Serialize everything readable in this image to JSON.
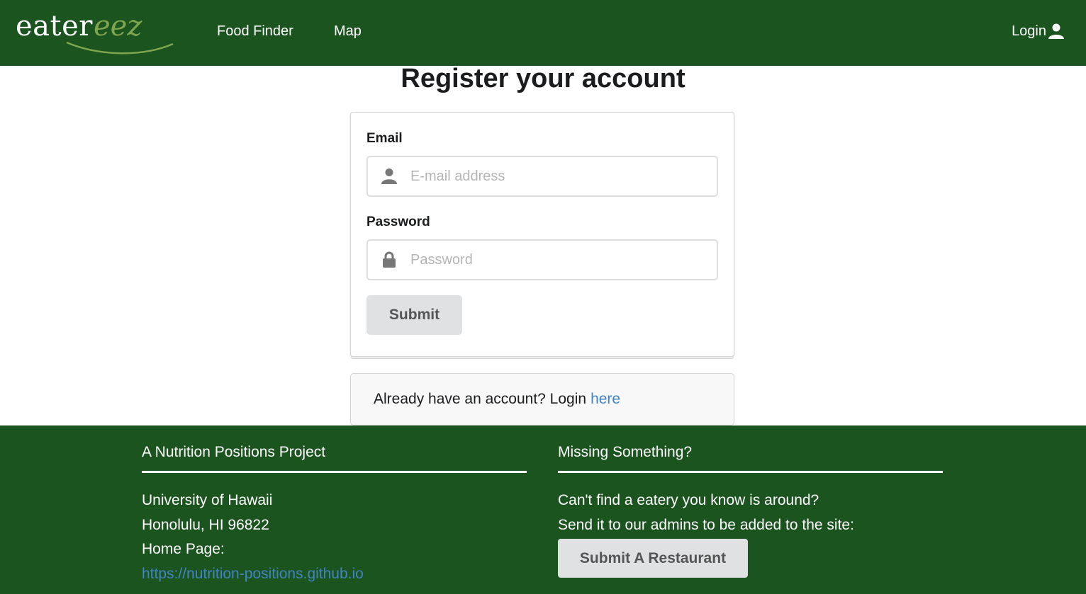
{
  "nav": {
    "logo_main": "eater",
    "logo_accent": "eez",
    "links": [
      "Food Finder",
      "Map"
    ],
    "login_label": "Login"
  },
  "page": {
    "title": "Register your account"
  },
  "form": {
    "email_label": "Email",
    "email_placeholder": "E-mail address",
    "email_value": "",
    "password_label": "Password",
    "password_placeholder": "Password",
    "password_value": "",
    "submit_label": "Submit"
  },
  "message": {
    "text": "Already have an account? Login",
    "link_text": "here"
  },
  "footer": {
    "left": {
      "heading": "A Nutrition Positions Project",
      "lines": [
        "University of Hawaii",
        "Honolulu, HI 96822",
        "Home Page:"
      ],
      "link": "https://nutrition-positions.github.io"
    },
    "right": {
      "heading": "Missing Something?",
      "lines": [
        "Can't find a eatery you know is around?",
        "Send it to our admins to be added to the site:"
      ],
      "button_label": "Submit A Restaurant"
    }
  },
  "colors": {
    "brand_green": "#1b541f",
    "logo_accent": "#7fa64f",
    "link_blue": "#4183c4",
    "button_gray": "#e0e1e2"
  }
}
